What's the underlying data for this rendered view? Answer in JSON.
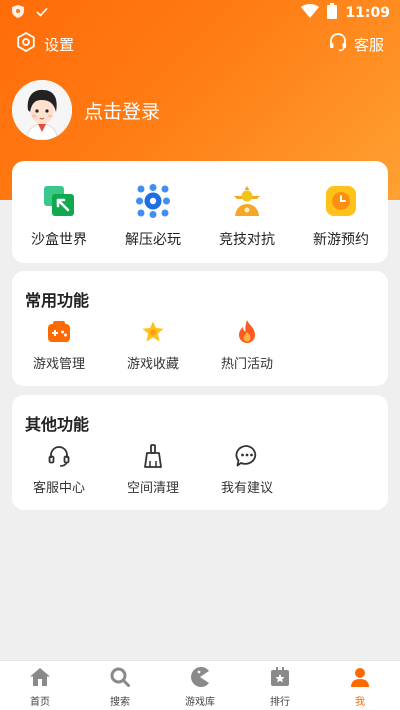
{
  "status": {
    "time": "11:09"
  },
  "topbar": {
    "settings_label": "设置",
    "service_label": "客服"
  },
  "profile": {
    "login_label": "点击登录"
  },
  "quick_items": [
    {
      "label": "沙盒世界",
      "icon": "sandbox-icon"
    },
    {
      "label": "解压必玩",
      "icon": "relax-icon"
    },
    {
      "label": "竞技对抗",
      "icon": "competition-icon"
    },
    {
      "label": "新游预约",
      "icon": "reserve-clock-icon"
    }
  ],
  "common": {
    "title": "常用功能",
    "items": [
      {
        "label": "游戏管理",
        "icon": "gamepad-icon"
      },
      {
        "label": "游戏收藏",
        "icon": "star-icon"
      },
      {
        "label": "热门活动",
        "icon": "fire-icon"
      }
    ]
  },
  "other": {
    "title": "其他功能",
    "items": [
      {
        "label": "客服中心",
        "icon": "headset-icon"
      },
      {
        "label": "空间清理",
        "icon": "broom-icon"
      },
      {
        "label": "我有建议",
        "icon": "chat-bubble-icon"
      }
    ]
  },
  "tabs": [
    {
      "label": "首页",
      "icon": "home-icon"
    },
    {
      "label": "搜索",
      "icon": "search-icon"
    },
    {
      "label": "游戏库",
      "icon": "game-library-icon"
    },
    {
      "label": "排行",
      "icon": "ranking-icon"
    },
    {
      "label": "我",
      "icon": "user-icon",
      "active": true
    }
  ],
  "colors": {
    "accent": "#ff6a00",
    "hero_start": "#ff6c0a",
    "hero_end": "#ffa133"
  }
}
